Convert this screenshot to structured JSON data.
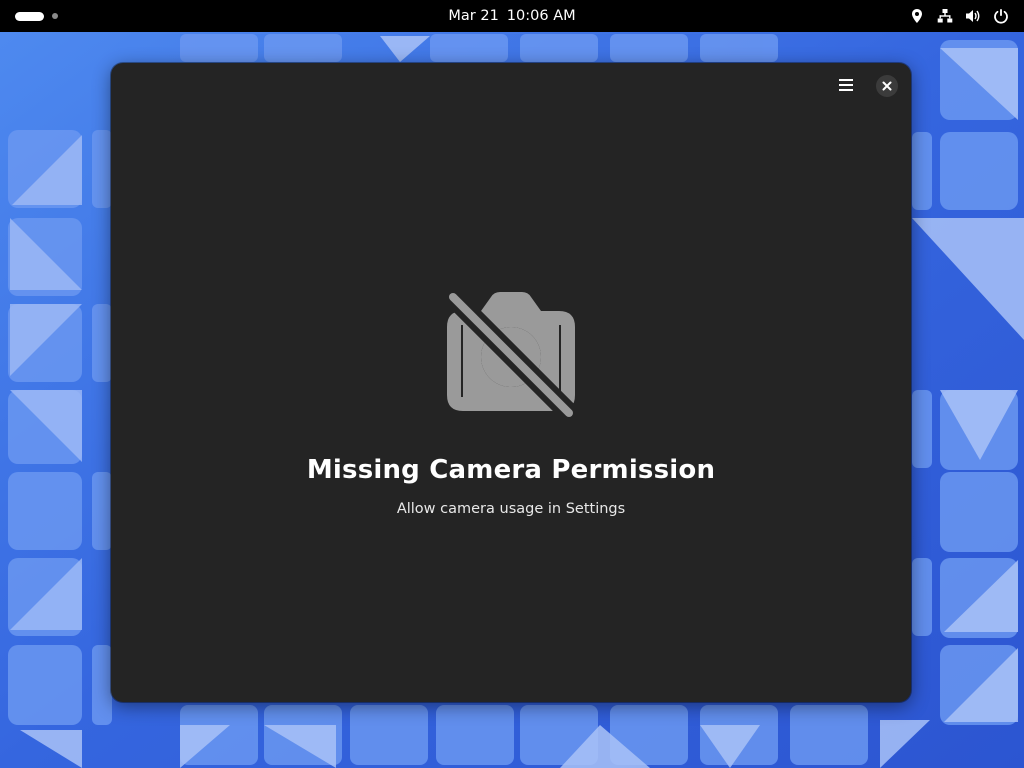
{
  "topbar": {
    "date": "Mar 21",
    "time": "10:06 AM",
    "status_icons": [
      "location-icon",
      "network-wired-icon",
      "volume-icon",
      "power-icon"
    ]
  },
  "window": {
    "title": "Missing Camera Permission",
    "description": "Allow camera usage in Settings",
    "icon": "camera-disabled-icon",
    "menu_icon": "hamburger-menu-icon",
    "close_icon": "close-icon"
  },
  "colors": {
    "window_bg": "#242424",
    "topbar_bg": "#000000",
    "icon_gray": "#9a9a9a",
    "wallpaper_blue": "#3d72e6"
  }
}
